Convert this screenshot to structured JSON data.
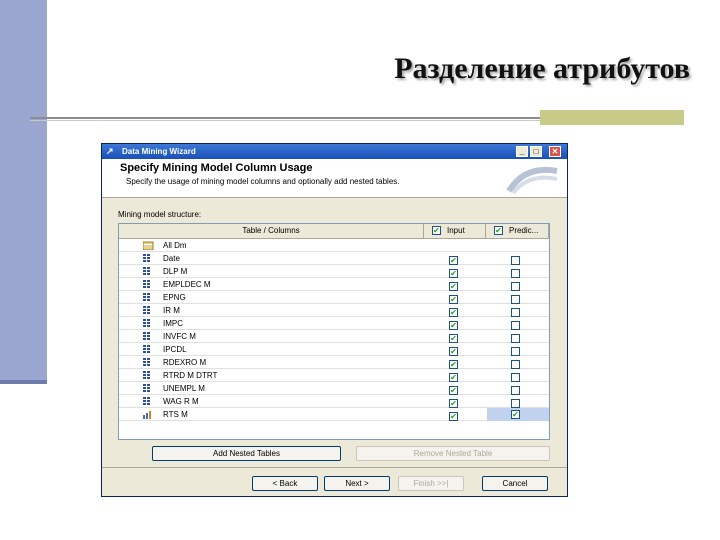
{
  "slide": {
    "title": "Разделение атрибутов"
  },
  "dialog": {
    "title": "Data Mining Wizard",
    "window_buttons": [
      "_",
      "□",
      "✕"
    ],
    "header_title": "Specify Mining Model Column Usage",
    "header_subtitle": "Specify the usage of mining model columns and optionally add nested tables.",
    "group_label": "Mining model structure:",
    "columns": {
      "table_column": "Table / Columns",
      "input": "Input",
      "predict": "Predic..."
    },
    "rows": [
      {
        "label": "All Dm",
        "icon": "table-key-icon",
        "input": null,
        "predict": null
      },
      {
        "label": "Date",
        "icon": "column-icon",
        "input": true,
        "predict": false
      },
      {
        "label": "DLP M",
        "icon": "column-icon",
        "input": true,
        "predict": false
      },
      {
        "label": "EMPLDEC M",
        "icon": "column-icon",
        "input": true,
        "predict": false
      },
      {
        "label": "EPNG",
        "icon": "column-icon",
        "input": true,
        "predict": false
      },
      {
        "label": "IR M",
        "icon": "column-icon",
        "input": true,
        "predict": false
      },
      {
        "label": "IMPC",
        "icon": "column-icon",
        "input": true,
        "predict": false
      },
      {
        "label": "INVFC M",
        "icon": "column-icon",
        "input": true,
        "predict": false
      },
      {
        "label": "IPCDL",
        "icon": "column-icon",
        "input": true,
        "predict": false
      },
      {
        "label": "RDEXRO M",
        "icon": "column-icon",
        "input": true,
        "predict": false
      },
      {
        "label": "RTRD M DTRT",
        "icon": "column-icon",
        "input": true,
        "predict": false
      },
      {
        "label": "UNEMPL M",
        "icon": "column-icon",
        "input": true,
        "predict": false
      },
      {
        "label": "WAG R M",
        "icon": "column-icon",
        "input": true,
        "predict": false
      },
      {
        "label": "RTS M",
        "icon": "predict-column-icon",
        "input": true,
        "predict": true
      }
    ],
    "buttons": {
      "add_nested": "Add Nested Tables",
      "remove_nested": "Remove Nested Table",
      "back": "< Back",
      "next": "Next >",
      "finish": "Finish >>|",
      "cancel": "Cancel"
    }
  }
}
